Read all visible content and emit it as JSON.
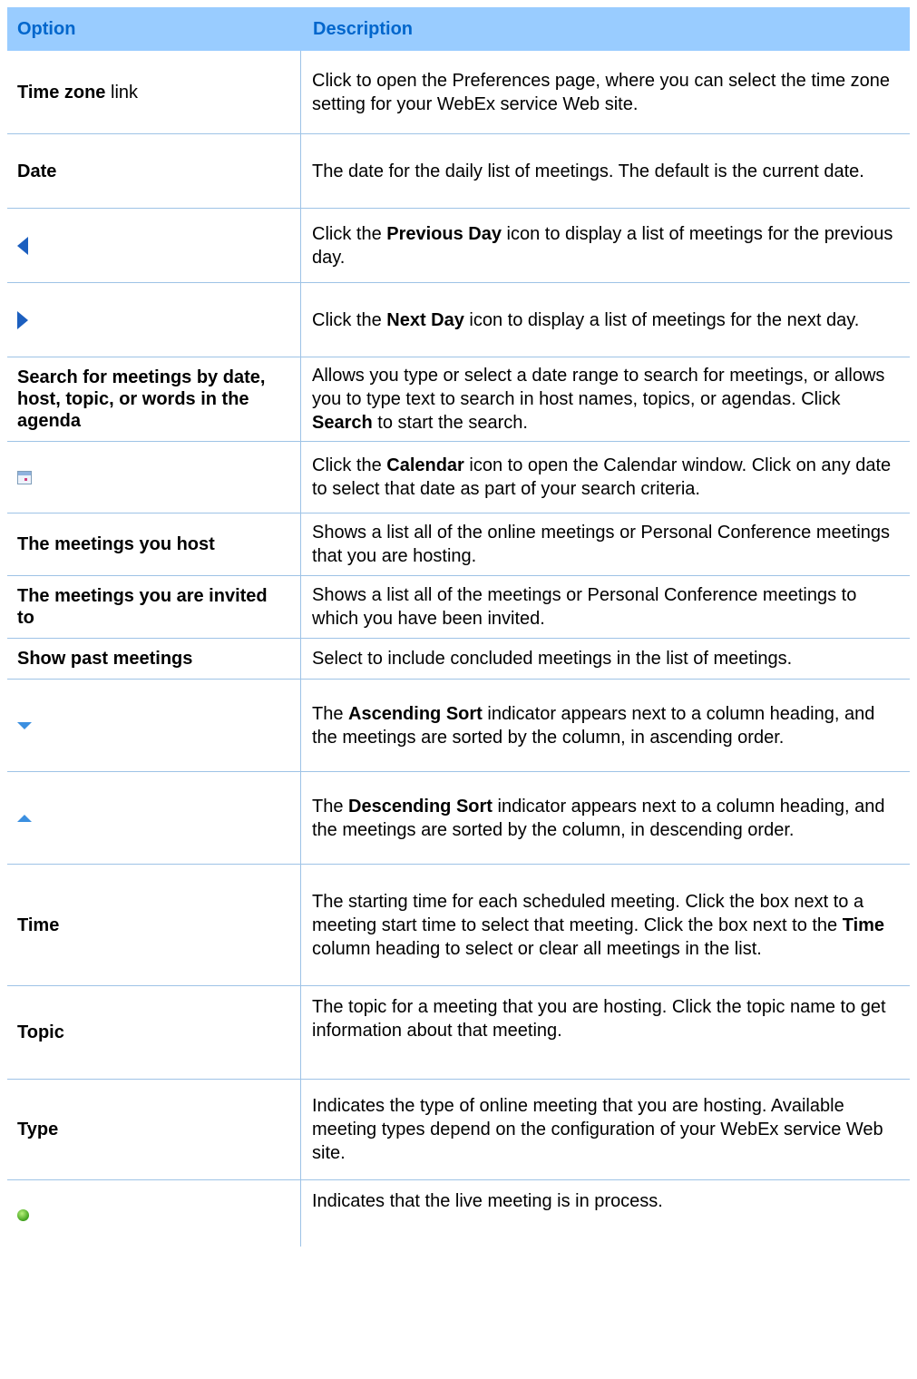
{
  "header": {
    "option": "Option",
    "description": "Description"
  },
  "rows": [
    {
      "option_bold": "Time zone",
      "option_plain": " link",
      "d": [
        "Click to open the Preferences page, where you can select the time zone setting for your WebEx service Web site."
      ]
    },
    {
      "option_bold": "Date",
      "d": [
        "The date for the daily list of meetings. The default is the current date."
      ]
    },
    {
      "icon": "previous-day-icon",
      "d": [
        "Click the ",
        "Previous Day",
        " icon to display a list of meetings for the previous day."
      ]
    },
    {
      "icon": "next-day-icon",
      "d": [
        "Click the ",
        "Next Day",
        " icon to display a list of meetings for the next day."
      ]
    },
    {
      "option_bold": "Search for meetings by date, host, topic, or words in the agenda",
      "d": [
        "Allows you type or select a date range to search for meetings, or allows you to type text to search in host names, topics, or agendas. Click ",
        "Search",
        " to start the search."
      ]
    },
    {
      "icon": "calendar-icon",
      "d": [
        "Click the ",
        "Calendar",
        " icon to open the Calendar window. Click on any date to select that date as part of your search criteria."
      ]
    },
    {
      "option_bold": "The meetings you host",
      "d": [
        "Shows a list all of the online meetings or Personal Conference meetings that you are hosting."
      ]
    },
    {
      "option_bold": "The meetings you are invited to",
      "d": [
        "Shows a list all of the meetings or Personal Conference meetings to which you have been invited."
      ]
    },
    {
      "option_bold": "Show past meetings",
      "d": [
        "Select to include concluded meetings in the list of meetings."
      ]
    },
    {
      "icon": "ascending-sort-icon",
      "d": [
        "The ",
        "Ascending Sort",
        " indicator appears next to a column heading, and the meetings are sorted by the column, in ascending order."
      ]
    },
    {
      "icon": "descending-sort-icon",
      "d": [
        "The ",
        "Descending Sort",
        " indicator appears next to a column heading, and the meetings are sorted by the column, in descending order."
      ]
    },
    {
      "option_bold": "Time",
      "d": [
        "The starting time for each scheduled meeting. Click the box next to a meeting start time to select that meeting. Click the box next to the ",
        "Time",
        " column heading to select or clear all meetings in the list."
      ]
    },
    {
      "option_bold": "Topic",
      "d": [
        "The topic for a meeting that you are hosting. Click the topic name to get information about that meeting."
      ]
    },
    {
      "option_bold": "Type",
      "d": [
        "Indicates the type of online meeting that you are hosting. Available meeting types depend on the configuration of your WebEx service Web site."
      ]
    },
    {
      "icon": "live-meeting-icon",
      "d": [
        "Indicates that the live meeting is in process."
      ]
    }
  ]
}
